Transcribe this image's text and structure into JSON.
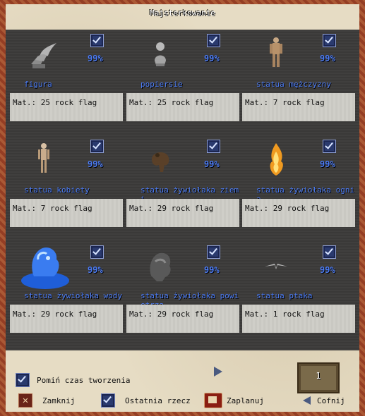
{
  "window": {
    "title": "Majsterkowanie"
  },
  "items": [
    {
      "name": "figura",
      "percent": "99%",
      "mat": "Mat.: 25 rock flag",
      "icon": "bird-statue-icon"
    },
    {
      "name": "popiersie",
      "percent": "99%",
      "mat": "Mat.: 25 rock flag",
      "icon": "bust-icon"
    },
    {
      "name": "statua mężczyzny",
      "percent": "99%",
      "mat": "Mat.: 7 rock flag",
      "icon": "male-statue-icon"
    },
    {
      "name": "statua kobiety",
      "percent": "99%",
      "mat": "Mat.: 7 rock flag",
      "icon": "female-statue-icon"
    },
    {
      "name": "statua żywiołaka ziemi",
      "percent": "99%",
      "mat": "Mat.: 29 rock flag",
      "icon": "earth-elemental-icon"
    },
    {
      "name": "statua żywiołaka ognia",
      "percent": "99%",
      "mat": "Mat.: 29 rock flag",
      "icon": "fire-elemental-icon"
    },
    {
      "name": "statua żywiołaka wody",
      "percent": "99%",
      "mat": "Mat.: 29 rock flag",
      "icon": "water-elemental-icon"
    },
    {
      "name": "statua żywiołaka powietrza",
      "percent": "99%",
      "mat": "Mat.: 29 rock flag",
      "icon": "air-elemental-icon"
    },
    {
      "name": "statua ptaka",
      "percent": "99%",
      "mat": "Mat.: 1 rock flag",
      "icon": "bird-icon"
    }
  ],
  "controls": {
    "skip_time_label": "Pomiń czas tworzenia",
    "close_label": "Zamknij",
    "last_item_label": "Ostatnia rzecz",
    "plan_label": "Zaplanuj",
    "back_label": "Cofnij",
    "amount": "1"
  }
}
